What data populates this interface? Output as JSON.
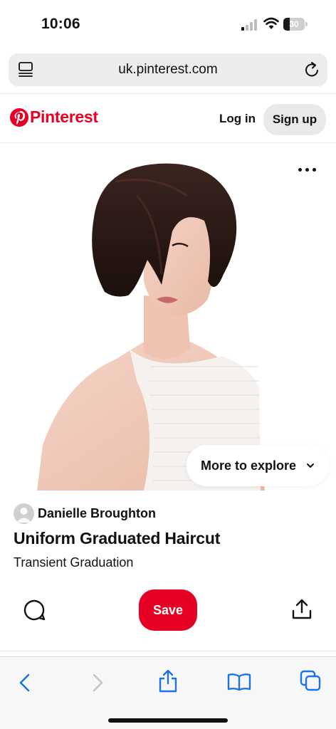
{
  "status_bar": {
    "time": "10:06",
    "battery_level": "30"
  },
  "browser": {
    "url": "uk.pinterest.com"
  },
  "header": {
    "logo_text": "Pinterest",
    "login_label": "Log in",
    "signup_label": "Sign up",
    "brand_color": "#e60023"
  },
  "pin": {
    "explore_label": "More to explore",
    "creator_name": "Danielle Broughton",
    "title": "Uniform Graduated Haircut",
    "description": "Transient Graduation",
    "save_label": "Save"
  },
  "icons": {
    "status": [
      "signal-icon",
      "wifi-icon",
      "battery-icon"
    ],
    "browser": [
      "tabs-menu-icon",
      "reload-icon"
    ],
    "pin": [
      "more-options-icon",
      "chevron-down-icon",
      "comment-icon",
      "share-icon"
    ],
    "toolbar": [
      "back-icon",
      "forward-icon",
      "share-sheet-icon",
      "bookmarks-icon",
      "tabs-icon"
    ]
  }
}
